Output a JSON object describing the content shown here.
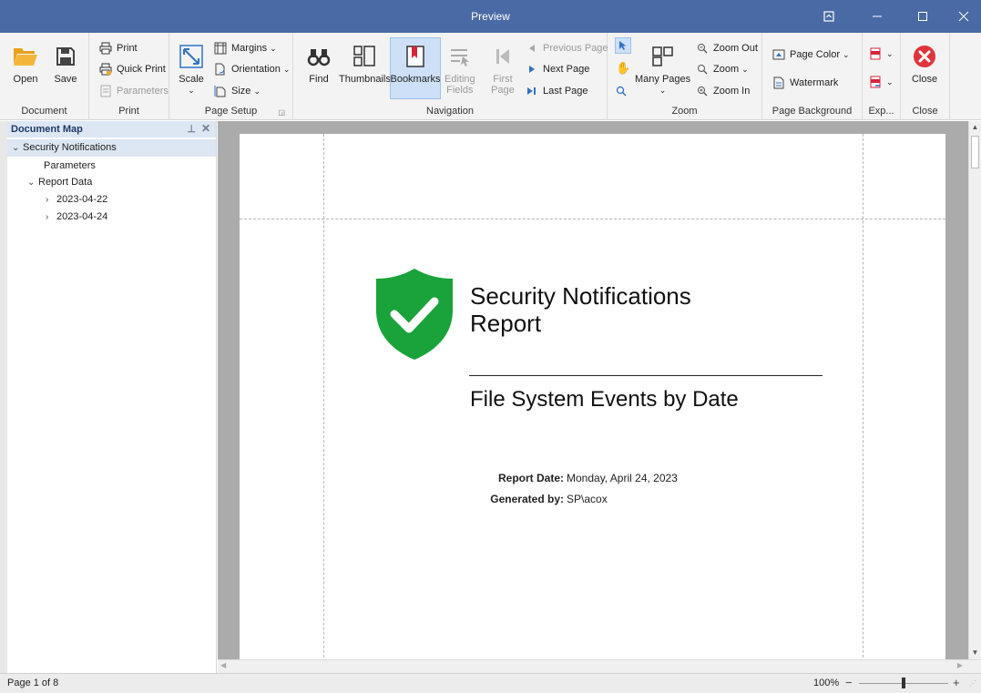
{
  "window": {
    "title": "Preview"
  },
  "ribbon": {
    "groups": {
      "document": "Document",
      "print": "Print",
      "page_setup": "Page Setup",
      "navigation": "Navigation",
      "zoom": "Zoom",
      "page_background": "Page Background",
      "export": "Exp...",
      "close": "Close"
    },
    "open": "Open",
    "save": "Save",
    "print": "Print",
    "quick_print": "Quick Print",
    "parameters": "Parameters",
    "scale": "Scale",
    "margins": "Margins",
    "orientation": "Orientation",
    "size": "Size",
    "find": "Find",
    "thumbnails": "Thumbnails",
    "bookmarks": "Bookmarks",
    "editing_fields_1": "Editing",
    "editing_fields_2": "Fields",
    "first_page_1": "First",
    "first_page_2": "Page",
    "previous_page": "Previous Page",
    "next_page": "Next Page",
    "last_page": "Last Page",
    "many_pages": "Many Pages",
    "zoom_out": "Zoom Out",
    "zoom": "Zoom",
    "zoom_in": "Zoom In",
    "page_color": "Page Color",
    "watermark": "Watermark",
    "close_btn": "Close"
  },
  "docmap": {
    "title": "Document Map",
    "items": [
      {
        "label": "Security Notifications"
      },
      {
        "label": "Parameters"
      },
      {
        "label": "Report Data"
      },
      {
        "label": "2023-04-22"
      },
      {
        "label": "2023-04-24"
      }
    ]
  },
  "report": {
    "title_line1": "Security Notifications",
    "title_line2": "Report",
    "subtitle": "File System Events by Date",
    "date_label": "Report Date:",
    "date_value": "Monday, April 24, 2023",
    "generated_label": "Generated by:",
    "generated_value": "SP\\acox"
  },
  "status": {
    "page": "Page 1 of 8",
    "zoom": "100%",
    "zoom_level": 1.0
  },
  "colors": {
    "titlebar": "#4a6aa5",
    "shield": "#1aa33a",
    "close_red": "#e0353b",
    "accent_blue": "#2f72c4"
  }
}
